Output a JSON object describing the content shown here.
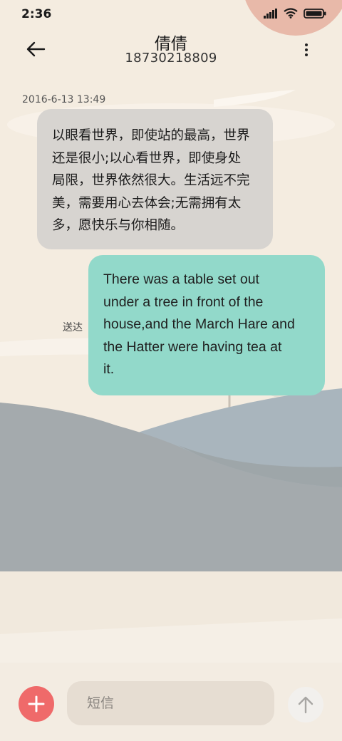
{
  "status_bar": {
    "time": "2:36",
    "icons": [
      "signal-icon",
      "wifi-icon",
      "battery-icon"
    ]
  },
  "header": {
    "contact_name": "倩倩",
    "phone_number": "18730218809",
    "back_icon": "back-arrow-icon",
    "more_icon": "more-vertical-icon"
  },
  "conversation": {
    "timestamp": "2016-6-13 13:49",
    "messages": [
      {
        "direction": "incoming",
        "lines": [
          "以眼看世界，即使站的最高，世界",
          "还是很小;以心看世界，即使身处",
          "局限，世界依然很大。生活远不完",
          "美，需要用心去体会;无需拥有太",
          "多，愿快乐与你相随。"
        ]
      },
      {
        "direction": "outgoing",
        "lines": [
          "There was a table set out",
          "under a tree in front of the",
          "house,and the March Hare and",
          "the Hatter were having tea at",
          "it."
        ],
        "status": "送达"
      }
    ]
  },
  "composer": {
    "placeholder": "短信",
    "value": "",
    "add_icon": "plus-icon",
    "send_icon": "send-arrow-up-icon"
  },
  "colors": {
    "background": "#f4ece0",
    "incoming_bubble": "#d7d4d0",
    "outgoing_bubble": "#92d9ca",
    "add_button": "#ef6a6a",
    "input_background": "#e6ddd2",
    "hills_dark": "#a4aaad",
    "hills_light": "#a9b5bd",
    "corner_circle": "#e8b9a9"
  }
}
